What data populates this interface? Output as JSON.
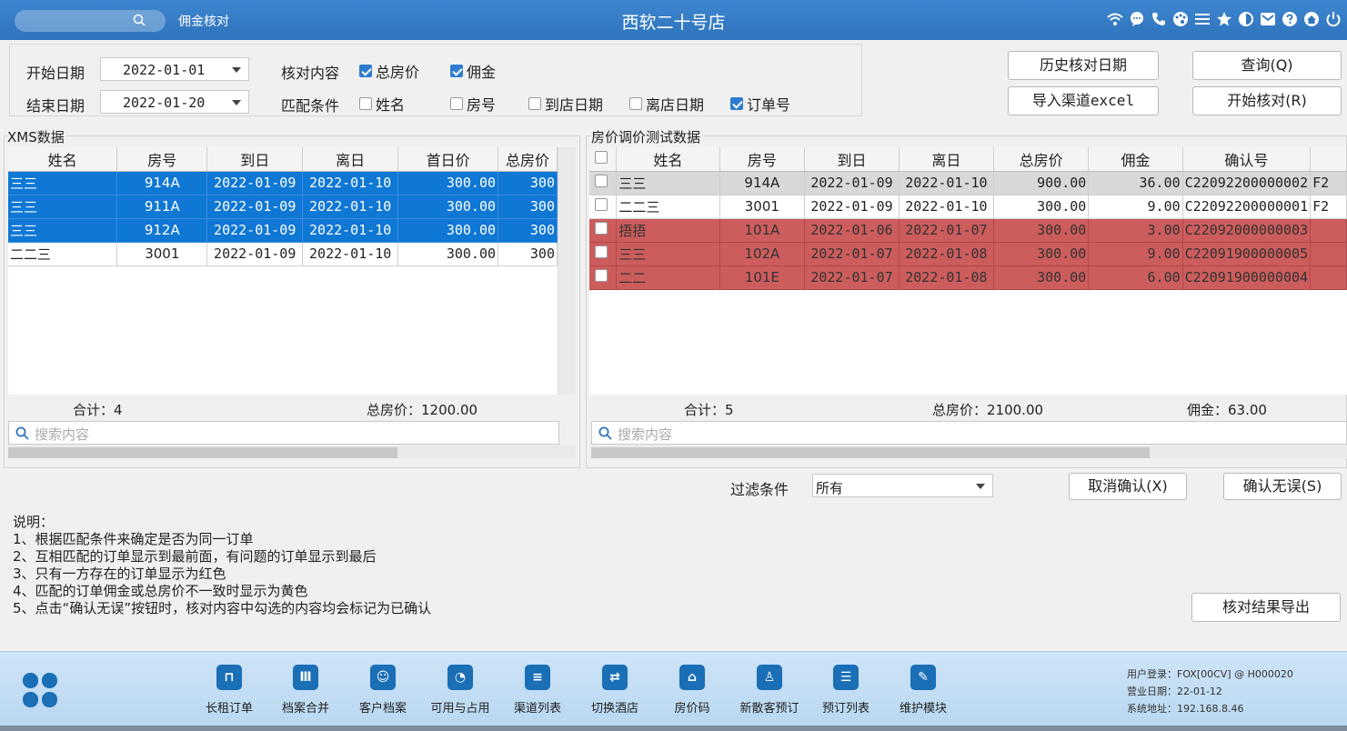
{
  "titlebar": {
    "module": "佣金核对",
    "store": "西软二十号店",
    "icons": [
      "wifi-icon",
      "chat-icon",
      "phone-icon",
      "palette-icon",
      "menu-icon",
      "star-icon",
      "contrast-icon",
      "mail-icon",
      "help-icon",
      "home-icon",
      "power-icon"
    ]
  },
  "filters": {
    "start_label": "开始日期",
    "start_value": "2022-01-01",
    "end_label": "结束日期",
    "end_value": "2022-01-20",
    "check_label": "核对内容",
    "check_items": [
      {
        "label": "总房价",
        "checked": true
      },
      {
        "label": "佣金",
        "checked": true
      }
    ],
    "match_label": "匹配条件",
    "match_items": [
      {
        "label": "姓名",
        "checked": false
      },
      {
        "label": "房号",
        "checked": false
      },
      {
        "label": "到店日期",
        "checked": false
      },
      {
        "label": "离店日期",
        "checked": false
      },
      {
        "label": "订单号",
        "checked": true
      }
    ]
  },
  "buttons": {
    "history": "历史核对日期",
    "query": "查询(Q)",
    "import": "导入渠道excel",
    "start": "开始核对(R)",
    "cancel_confirm": "取消确认(X)",
    "confirm_ok": "确认无误(S)",
    "export": "核对结果导出"
  },
  "left_panel": {
    "title": "XMS数据",
    "columns": [
      "姓名",
      "房号",
      "到日",
      "离日",
      "首日价",
      "总房价"
    ],
    "rows": [
      {
        "name": "三三",
        "room": "914A",
        "arr": "2022-01-09",
        "dep": "2022-01-10",
        "first": "300.00",
        "total": "300",
        "style": "sel"
      },
      {
        "name": "三三",
        "room": "911A",
        "arr": "2022-01-09",
        "dep": "2022-01-10",
        "first": "300.00",
        "total": "300",
        "style": "sel"
      },
      {
        "name": "三三",
        "room": "912A",
        "arr": "2022-01-09",
        "dep": "2022-01-10",
        "first": "300.00",
        "total": "300",
        "style": "sel"
      },
      {
        "name": "二二三",
        "room": "3001",
        "arr": "2022-01-09",
        "dep": "2022-01-10",
        "first": "300.00",
        "total": "300",
        "style": "white"
      }
    ],
    "sum_count": "合计：4",
    "sum_total": "总房价：1200.00",
    "search_placeholder": "搜索内容"
  },
  "right_panel": {
    "title": "房价调价测试数据",
    "columns": [
      "姓名",
      "房号",
      "到日",
      "离日",
      "总房价",
      "佣金",
      "确认号"
    ],
    "rows": [
      {
        "name": "三三",
        "room": "914A",
        "arr": "2022-01-09",
        "dep": "2022-01-10",
        "total": "900.00",
        "comm": "36.00",
        "conf": "C22092200000002",
        "extra": "F2",
        "style": "gray"
      },
      {
        "name": "二二三",
        "room": "3001",
        "arr": "2022-01-09",
        "dep": "2022-01-10",
        "total": "300.00",
        "comm": "9.00",
        "conf": "C22092200000001",
        "extra": "F2",
        "style": "white"
      },
      {
        "name": "捂捂",
        "room": "101A",
        "arr": "2022-01-06",
        "dep": "2022-01-07",
        "total": "300.00",
        "comm": "3.00",
        "conf": "C22092000000003",
        "extra": "",
        "style": "red"
      },
      {
        "name": "三三",
        "room": "102A",
        "arr": "2022-01-07",
        "dep": "2022-01-08",
        "total": "300.00",
        "comm": "9.00",
        "conf": "C22091900000005",
        "extra": "",
        "style": "red"
      },
      {
        "name": "二二",
        "room": "101E",
        "arr": "2022-01-07",
        "dep": "2022-01-08",
        "total": "300.00",
        "comm": "6.00",
        "conf": "C22091900000004",
        "extra": "",
        "style": "red"
      }
    ],
    "sum_count": "合计：5",
    "sum_total": "总房价：2100.00",
    "sum_comm": "佣金：63.00",
    "search_placeholder": "搜索内容"
  },
  "filter_bar": {
    "label": "过滤条件",
    "value": "所有"
  },
  "notes": [
    "说明：",
    "1、根据匹配条件来确定是否为同一订单",
    "2、互相匹配的订单显示到最前面，有问题的订单显示到最后",
    "3、只有一方存在的订单显示为红色",
    "4、匹配的订单佣金或总房价不一致时显示为黄色",
    "5、点击“确认无误”按钮时，核对内容中勾选的内容均会标记为已确认"
  ],
  "taskbar": {
    "items": [
      {
        "label": "长租订单",
        "icon": "suitcase-icon",
        "glyph": "⊓"
      },
      {
        "label": "档案合并",
        "icon": "merge-icon",
        "glyph": "Ⅲ"
      },
      {
        "label": "客户档案",
        "icon": "profile-icon",
        "glyph": "☺"
      },
      {
        "label": "可用与占用",
        "icon": "pie-chart-icon",
        "glyph": "◔"
      },
      {
        "label": "渠道列表",
        "icon": "clipboard-icon",
        "glyph": "≡"
      },
      {
        "label": "切换酒店",
        "icon": "switch-icon",
        "glyph": "⇄"
      },
      {
        "label": "房价码",
        "icon": "house-icon",
        "glyph": "⌂"
      },
      {
        "label": "新散客预订",
        "icon": "new-guest-icon",
        "glyph": "♙"
      },
      {
        "label": "预订列表",
        "icon": "booking-list-icon",
        "glyph": "☰"
      },
      {
        "label": "维护模块",
        "icon": "wrench-icon",
        "glyph": "✎"
      }
    ],
    "user_login": "用户登录：FOX[00CV] @ H000020",
    "business_date": "营业日期：22-01-12",
    "system_address": "系统地址：192.168.8.46"
  },
  "colors": {
    "title_blue": "#2f74bd",
    "select_blue": "#0f77d4",
    "red_row": "#cd5c5c",
    "icon_blue": "#1a6fb6"
  }
}
